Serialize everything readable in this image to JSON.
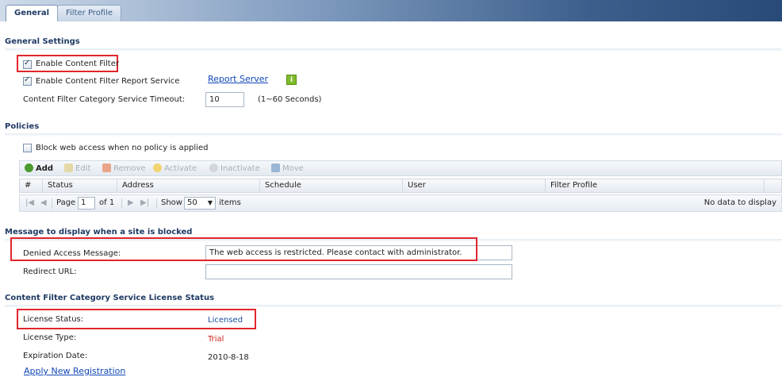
{
  "tabs": [
    {
      "label": "General",
      "active": true
    },
    {
      "label": "Filter Profile",
      "active": false
    }
  ],
  "general_settings": {
    "title": "General Settings",
    "enable_content_filter": {
      "label": "Enable Content Filter",
      "checked": true
    },
    "enable_report_service": {
      "label": "Enable Content Filter Report Service",
      "checked": true
    },
    "report_server_link": "Report Server",
    "info_icon": "i",
    "timeout_label": "Content Filter Category Service Timeout:",
    "timeout_value": "10",
    "timeout_hint": "(1~60 Seconds)"
  },
  "policies": {
    "title": "Policies",
    "block_label": "Block web access when no policy is applied",
    "block_checked": false,
    "toolbar": {
      "add": "Add",
      "edit": "Edit",
      "remove": "Remove",
      "activate": "Activate",
      "inactivate": "Inactivate",
      "move": "Move"
    },
    "columns": [
      "#",
      "Status",
      "Address",
      "Schedule",
      "User",
      "Filter Profile"
    ],
    "pager": {
      "page_label": "Page",
      "page_value": "1",
      "of_label": "of 1",
      "show_label": "Show",
      "show_value": "50",
      "items_label": "items",
      "no_data": "No data to display"
    }
  },
  "blocked_message": {
    "title": "Message to display when a site is blocked",
    "denied_label": "Denied Access Message:",
    "denied_value": "The web access is restricted. Please contact with administrator.",
    "redirect_label": "Redirect URL:",
    "redirect_value": ""
  },
  "license": {
    "title": "Content Filter Category Service License Status",
    "status_label": "License Status:",
    "status_value": "Licensed",
    "type_label": "License Type:",
    "type_value": "Trial",
    "expiration_label": "Expiration Date:",
    "expiration_value": "2010-8-18",
    "apply_link": "Apply New Registration"
  },
  "colors": {
    "accent_blue": "#1f3a64",
    "link_blue": "#1248b8",
    "licensed": "#1a4fa0",
    "trial": "#d0261c",
    "highlight_red": "#e1262d"
  }
}
